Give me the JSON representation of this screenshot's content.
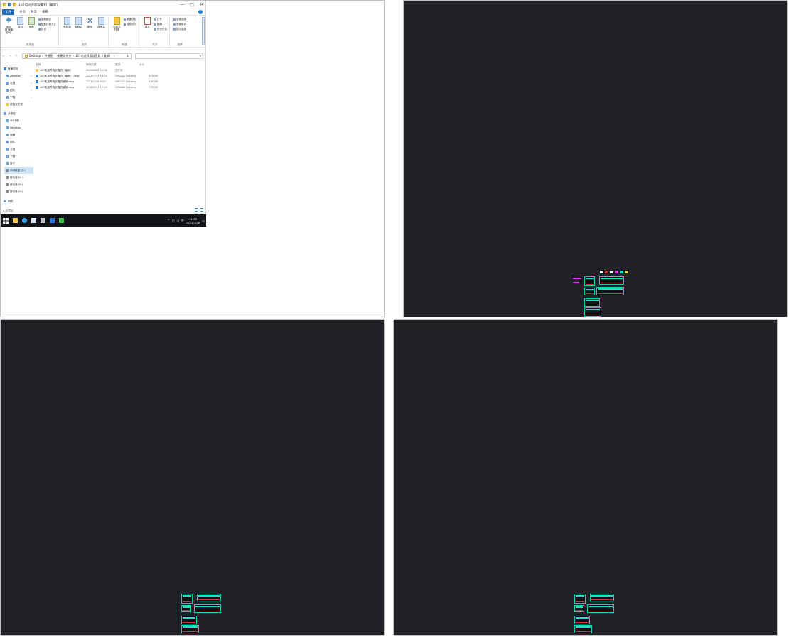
{
  "explorer": {
    "title": "107电池界面设置机（最新）",
    "window_controls": [
      "—",
      "□",
      "✕"
    ],
    "tabs": [
      "文件",
      "主页",
      "共享",
      "查看"
    ],
    "ribbon": {
      "clipboard": {
        "label": "剪贴板",
        "pin": "固定到'快速访问'",
        "copy": "复制",
        "paste": "粘贴",
        "cut": "剪切",
        "copy_path": "复制路径",
        "paste_shortcut": "粘贴快捷方式"
      },
      "organize": {
        "label": "组织",
        "move_to": "移动到",
        "copy_to": "复制到",
        "delete": "删除",
        "rename": "重命名"
      },
      "new": {
        "label": "新建",
        "new_folder": "新建文件夹",
        "new_item": "新建项目",
        "easy_access": "轻松访问"
      },
      "open": {
        "label": "打开",
        "properties": "属性",
        "open": "打开",
        "edit": "编辑",
        "history": "历史记录"
      },
      "select": {
        "label": "选择",
        "select_all": "全部选择",
        "select_none": "全部取消",
        "invert": "反向选择"
      }
    },
    "address": {
      "nav_arrows": "← → ↑",
      "path": [
        "Desktop",
        "外星图",
        "新建文件夹",
        "107电池界面设置机（最新）"
      ],
      "refresh": "↻",
      "search_icon": "⌕"
    },
    "nav_pane": [
      {
        "label": "快速访问",
        "kind": "star"
      },
      {
        "label": "Desktop",
        "kind": "item",
        "pinned": true
      },
      {
        "label": "文档",
        "kind": "item",
        "pinned": true
      },
      {
        "label": "图片",
        "kind": "item",
        "pinned": true
      },
      {
        "label": "下载",
        "kind": "item",
        "pinned": true
      },
      {
        "label": "新建文件夹",
        "kind": "folder",
        "pinned": false
      },
      {
        "label": "此电脑",
        "kind": "pc"
      },
      {
        "label": "3D 对象",
        "kind": "item"
      },
      {
        "label": "Desktop",
        "kind": "item"
      },
      {
        "label": "视频",
        "kind": "item"
      },
      {
        "label": "图片",
        "kind": "item"
      },
      {
        "label": "文档",
        "kind": "item"
      },
      {
        "label": "下载",
        "kind": "item"
      },
      {
        "label": "音乐",
        "kind": "item"
      },
      {
        "label": "本地磁盘 (C:)",
        "kind": "drive",
        "selected": true
      },
      {
        "label": "新加卷 (D:)",
        "kind": "drive"
      },
      {
        "label": "新加卷 (E:)",
        "kind": "drive"
      },
      {
        "label": "新加卷 (E:)",
        "kind": "drive"
      },
      {
        "label": "网络",
        "kind": "net"
      }
    ],
    "columns": [
      "名称",
      "修改日期",
      "类型",
      "大小"
    ],
    "files": [
      {
        "name": "107电池界面设置机（最新）",
        "date": "2021/3/26 11:06",
        "type": "文件夹",
        "size": "",
        "icon": "folder"
      },
      {
        "name": "107电池界面设置机（最新）.dwg",
        "date": "2016/7/15 16:14",
        "type": "ZWCAD Drawing",
        "size": "425 KB",
        "icon": "dwg"
      },
      {
        "name": "107电池界面设置机最新.dwg",
        "date": "2016/7/14 9:25",
        "type": "ZWCAD Drawing",
        "size": "837 KB",
        "icon": "dwg"
      },
      {
        "name": "107电池界面设置机最新.dwg",
        "date": "2008/6/21 17:19",
        "type": "ZWCAD Drawing",
        "size": "735 KB",
        "icon": "dwg"
      }
    ],
    "status": "4 个项目",
    "taskbar": {
      "time": "11:25",
      "date": "2021/3/26",
      "ime": "中"
    }
  },
  "colors": {
    "cad_background": "#1f2127",
    "cad_sheet_line": "#0fd0c0",
    "cad_red": "#e02b2b",
    "cad_magenta": "#e23ce8",
    "file_tab": "#1f6fc5"
  }
}
